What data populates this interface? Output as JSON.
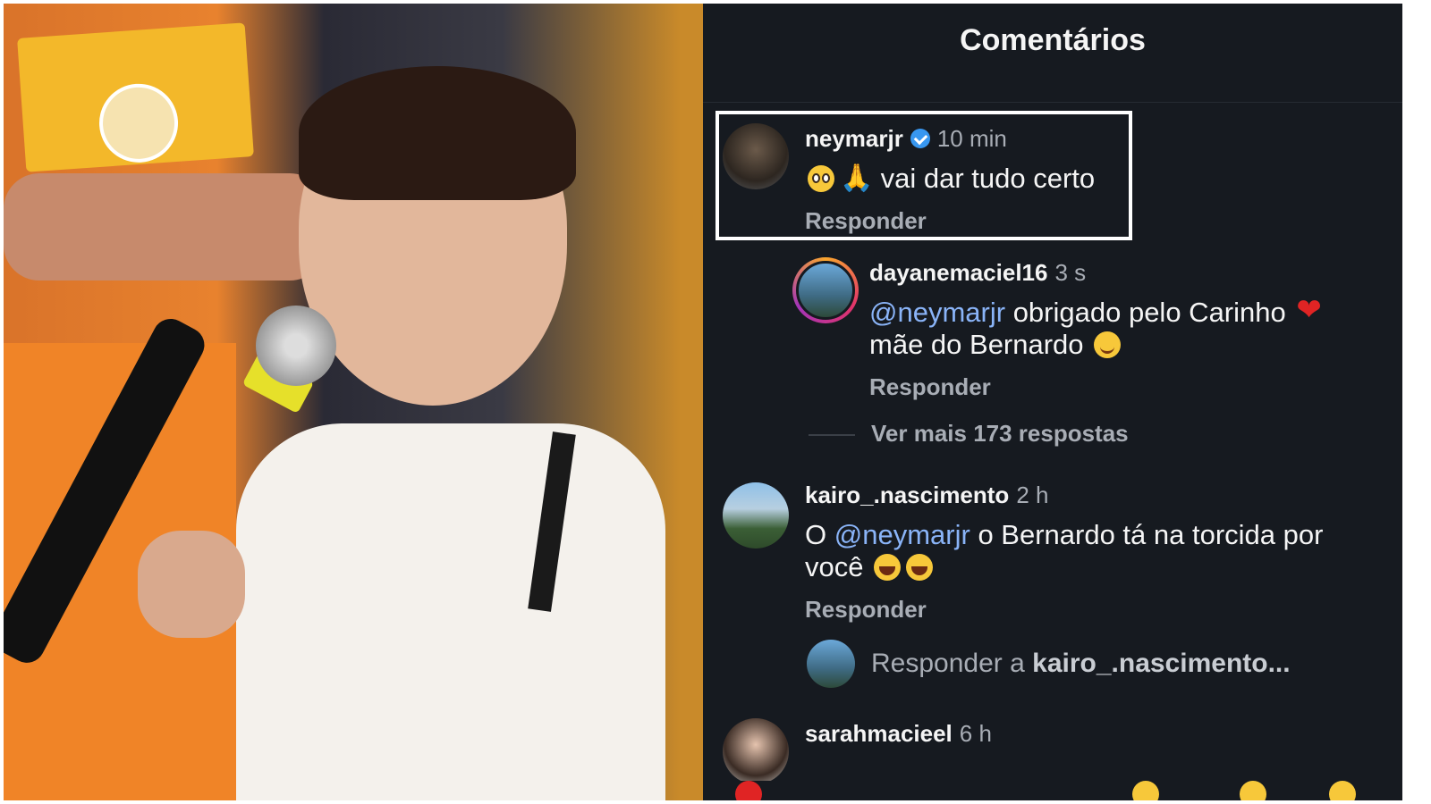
{
  "panel": {
    "title": "Comentários"
  },
  "comments": [
    {
      "user": "neymarjr",
      "verified": true,
      "time": "10 min",
      "emojis": [
        "pleading-face",
        "folded-hands"
      ],
      "text": "vai dar tudo certo",
      "reply_label": "Responder",
      "highlighted": true
    },
    {
      "user": "dayanemaciel16",
      "time": "3 s",
      "mention": "@neymarjr",
      "text_line1": "obrigado pelo Carinho",
      "text_line2": "mãe do Bernardo",
      "emojis": [
        "red-heart",
        "smiling-face-with-hearts"
      ],
      "reply_label": "Responder",
      "is_reply": true
    },
    {
      "user": "kairo_.nascimento",
      "time": "2 h",
      "prefix": "O",
      "mention": "@neymarjr",
      "text_line1": "o Bernardo tá na torcida por",
      "text_line2": "você",
      "emojis": [
        "face-with-tears-of-joy",
        "face-with-tears-of-joy"
      ],
      "reply_label": "Responder"
    },
    {
      "user": "sarahmacieel",
      "time": "6 h"
    }
  ],
  "view_more": "Ver mais 173 respostas",
  "reply_input": {
    "prefix": "Responder a",
    "target": "kairo_.nascimento..."
  },
  "colors": {
    "panel_bg": "#161a20",
    "mention": "#8ab4f8",
    "verified": "#3897f0",
    "highlight_border": "#ffffff"
  }
}
